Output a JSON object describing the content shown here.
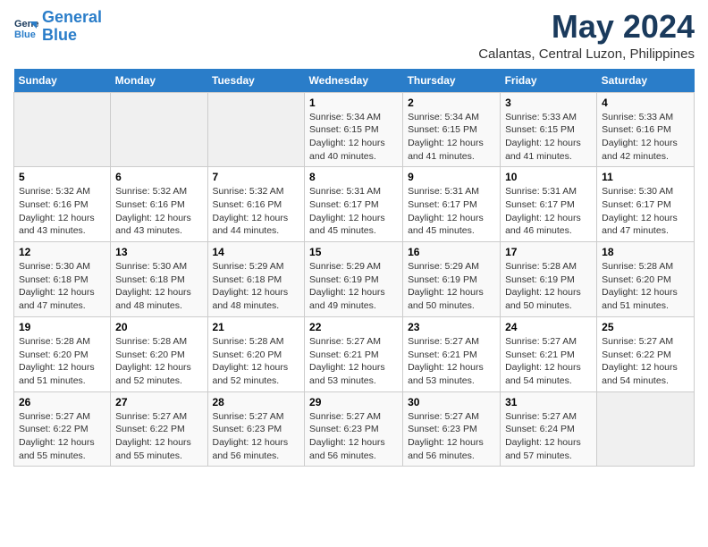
{
  "header": {
    "logo_line1": "General",
    "logo_line2": "Blue",
    "title": "May 2024",
    "subtitle": "Calantas, Central Luzon, Philippines"
  },
  "weekdays": [
    "Sunday",
    "Monday",
    "Tuesday",
    "Wednesday",
    "Thursday",
    "Friday",
    "Saturday"
  ],
  "weeks": [
    [
      {
        "day": "",
        "info": ""
      },
      {
        "day": "",
        "info": ""
      },
      {
        "day": "",
        "info": ""
      },
      {
        "day": "1",
        "info": "Sunrise: 5:34 AM\nSunset: 6:15 PM\nDaylight: 12 hours\nand 40 minutes."
      },
      {
        "day": "2",
        "info": "Sunrise: 5:34 AM\nSunset: 6:15 PM\nDaylight: 12 hours\nand 41 minutes."
      },
      {
        "day": "3",
        "info": "Sunrise: 5:33 AM\nSunset: 6:15 PM\nDaylight: 12 hours\nand 41 minutes."
      },
      {
        "day": "4",
        "info": "Sunrise: 5:33 AM\nSunset: 6:16 PM\nDaylight: 12 hours\nand 42 minutes."
      }
    ],
    [
      {
        "day": "5",
        "info": "Sunrise: 5:32 AM\nSunset: 6:16 PM\nDaylight: 12 hours\nand 43 minutes."
      },
      {
        "day": "6",
        "info": "Sunrise: 5:32 AM\nSunset: 6:16 PM\nDaylight: 12 hours\nand 43 minutes."
      },
      {
        "day": "7",
        "info": "Sunrise: 5:32 AM\nSunset: 6:16 PM\nDaylight: 12 hours\nand 44 minutes."
      },
      {
        "day": "8",
        "info": "Sunrise: 5:31 AM\nSunset: 6:17 PM\nDaylight: 12 hours\nand 45 minutes."
      },
      {
        "day": "9",
        "info": "Sunrise: 5:31 AM\nSunset: 6:17 PM\nDaylight: 12 hours\nand 45 minutes."
      },
      {
        "day": "10",
        "info": "Sunrise: 5:31 AM\nSunset: 6:17 PM\nDaylight: 12 hours\nand 46 minutes."
      },
      {
        "day": "11",
        "info": "Sunrise: 5:30 AM\nSunset: 6:17 PM\nDaylight: 12 hours\nand 47 minutes."
      }
    ],
    [
      {
        "day": "12",
        "info": "Sunrise: 5:30 AM\nSunset: 6:18 PM\nDaylight: 12 hours\nand 47 minutes."
      },
      {
        "day": "13",
        "info": "Sunrise: 5:30 AM\nSunset: 6:18 PM\nDaylight: 12 hours\nand 48 minutes."
      },
      {
        "day": "14",
        "info": "Sunrise: 5:29 AM\nSunset: 6:18 PM\nDaylight: 12 hours\nand 48 minutes."
      },
      {
        "day": "15",
        "info": "Sunrise: 5:29 AM\nSunset: 6:19 PM\nDaylight: 12 hours\nand 49 minutes."
      },
      {
        "day": "16",
        "info": "Sunrise: 5:29 AM\nSunset: 6:19 PM\nDaylight: 12 hours\nand 50 minutes."
      },
      {
        "day": "17",
        "info": "Sunrise: 5:28 AM\nSunset: 6:19 PM\nDaylight: 12 hours\nand 50 minutes."
      },
      {
        "day": "18",
        "info": "Sunrise: 5:28 AM\nSunset: 6:20 PM\nDaylight: 12 hours\nand 51 minutes."
      }
    ],
    [
      {
        "day": "19",
        "info": "Sunrise: 5:28 AM\nSunset: 6:20 PM\nDaylight: 12 hours\nand 51 minutes."
      },
      {
        "day": "20",
        "info": "Sunrise: 5:28 AM\nSunset: 6:20 PM\nDaylight: 12 hours\nand 52 minutes."
      },
      {
        "day": "21",
        "info": "Sunrise: 5:28 AM\nSunset: 6:20 PM\nDaylight: 12 hours\nand 52 minutes."
      },
      {
        "day": "22",
        "info": "Sunrise: 5:27 AM\nSunset: 6:21 PM\nDaylight: 12 hours\nand 53 minutes."
      },
      {
        "day": "23",
        "info": "Sunrise: 5:27 AM\nSunset: 6:21 PM\nDaylight: 12 hours\nand 53 minutes."
      },
      {
        "day": "24",
        "info": "Sunrise: 5:27 AM\nSunset: 6:21 PM\nDaylight: 12 hours\nand 54 minutes."
      },
      {
        "day": "25",
        "info": "Sunrise: 5:27 AM\nSunset: 6:22 PM\nDaylight: 12 hours\nand 54 minutes."
      }
    ],
    [
      {
        "day": "26",
        "info": "Sunrise: 5:27 AM\nSunset: 6:22 PM\nDaylight: 12 hours\nand 55 minutes."
      },
      {
        "day": "27",
        "info": "Sunrise: 5:27 AM\nSunset: 6:22 PM\nDaylight: 12 hours\nand 55 minutes."
      },
      {
        "day": "28",
        "info": "Sunrise: 5:27 AM\nSunset: 6:23 PM\nDaylight: 12 hours\nand 56 minutes."
      },
      {
        "day": "29",
        "info": "Sunrise: 5:27 AM\nSunset: 6:23 PM\nDaylight: 12 hours\nand 56 minutes."
      },
      {
        "day": "30",
        "info": "Sunrise: 5:27 AM\nSunset: 6:23 PM\nDaylight: 12 hours\nand 56 minutes."
      },
      {
        "day": "31",
        "info": "Sunrise: 5:27 AM\nSunset: 6:24 PM\nDaylight: 12 hours\nand 57 minutes."
      },
      {
        "day": "",
        "info": ""
      }
    ]
  ]
}
